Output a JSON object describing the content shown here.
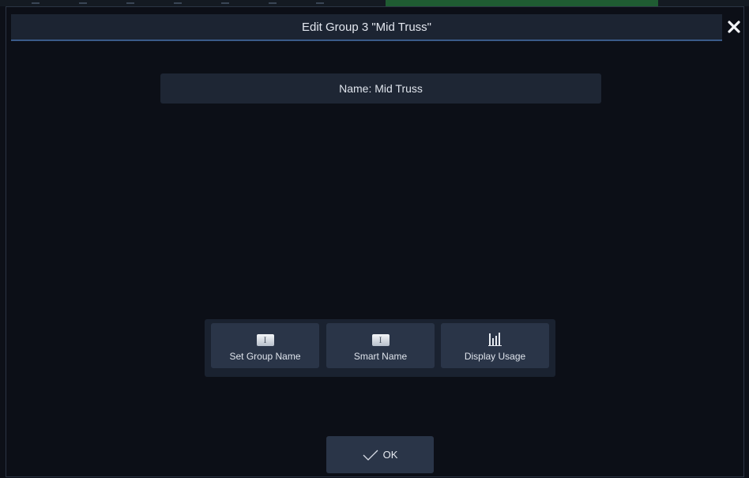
{
  "dialog": {
    "title": "Edit Group 3 \"Mid Truss\"",
    "close_icon": "close-icon"
  },
  "name_field": {
    "label": "Name: Mid Truss"
  },
  "actions": [
    {
      "label": "Set Group Name",
      "icon": "text-cursor-icon"
    },
    {
      "label": "Smart Name",
      "icon": "text-cursor-icon"
    },
    {
      "label": "Display Usage",
      "icon": "bar-chart-icon"
    }
  ],
  "ok_button": {
    "label": "OK",
    "icon": "checkmark-icon"
  },
  "colors": {
    "background": "#0c0f17",
    "title_bar": "#1c2432",
    "button": "#2a3548",
    "text": "#dfe4ec"
  }
}
